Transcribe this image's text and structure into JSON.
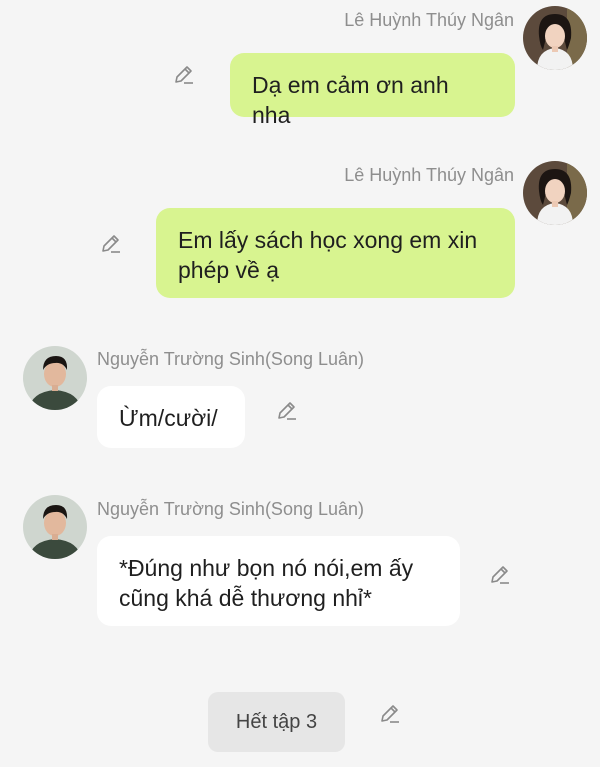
{
  "messages": [
    {
      "sender": "Lê Huỳnh Thúy Ngân",
      "text": "Dạ em cảm ơn anh nha",
      "side": "right",
      "bubble_color": "#d8f490",
      "avatar": "female-avatar",
      "edit_icon": "pencil-icon"
    },
    {
      "sender": "Lê Huỳnh Thúy Ngân",
      "text": "Em lấy sách học xong em xin phép về ạ",
      "side": "right",
      "bubble_color": "#d8f490",
      "avatar": "female-avatar",
      "edit_icon": "pencil-icon"
    },
    {
      "sender": "Nguyễn Trường Sinh(Song Luân)",
      "text": "Ừm/cười/",
      "side": "left",
      "bubble_color": "#ffffff",
      "avatar": "male-avatar",
      "edit_icon": "pencil-icon"
    },
    {
      "sender": "Nguyễn Trường Sinh(Song Luân)",
      "text": "*Đúng như bọn nó nói,em ấy cũng khá dễ thương nhỉ*",
      "side": "left",
      "bubble_color": "#ffffff",
      "avatar": "male-avatar",
      "edit_icon": "pencil-icon"
    }
  ],
  "end_marker": {
    "label": "Hết tập 3",
    "edit_icon": "pencil-icon"
  },
  "colors": {
    "background": "#f5f5f5",
    "green_bubble": "#d8f490",
    "white_bubble": "#ffffff",
    "sender_name": "#8e8e8e",
    "end_chip": "#e6e6e6"
  }
}
